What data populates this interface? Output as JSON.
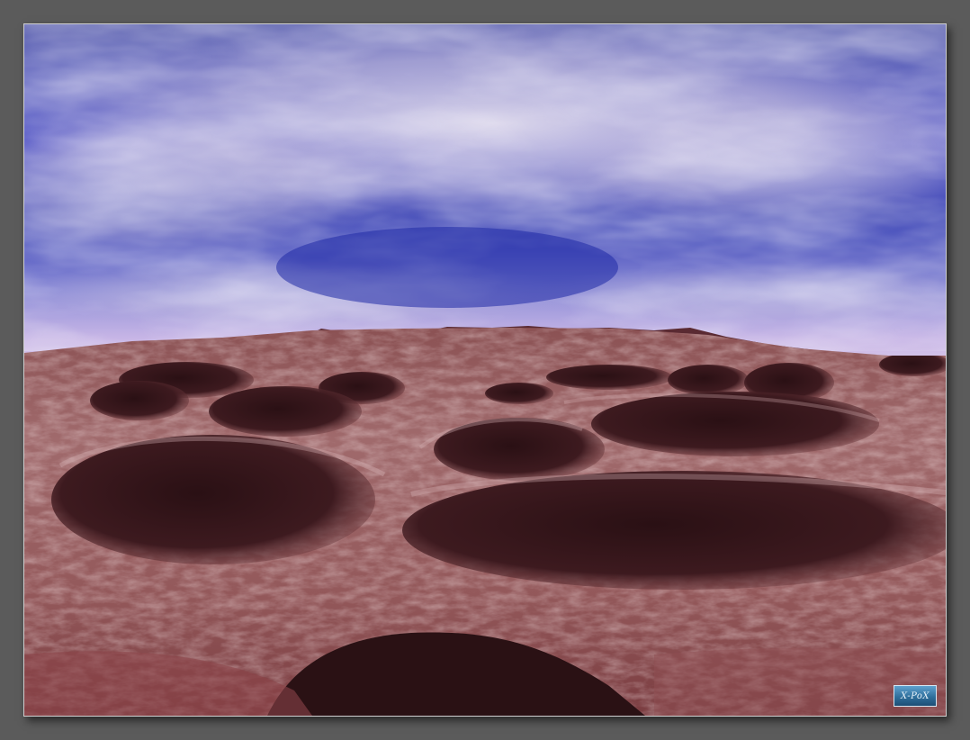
{
  "scene": {
    "subject": "alien-cratered-terrain",
    "sky_colors": {
      "zenith": "#2633a8",
      "mid": "#5a5fd0",
      "haze": "#c9b8e4",
      "cloud": "#d8d2e8"
    },
    "ground_colors": {
      "rock": "#9a5e60",
      "light_rock": "#c9a2a4",
      "shadow": "#3a1a1e",
      "deep": "#24100f"
    }
  },
  "watermark": {
    "text": "X-PoX"
  }
}
